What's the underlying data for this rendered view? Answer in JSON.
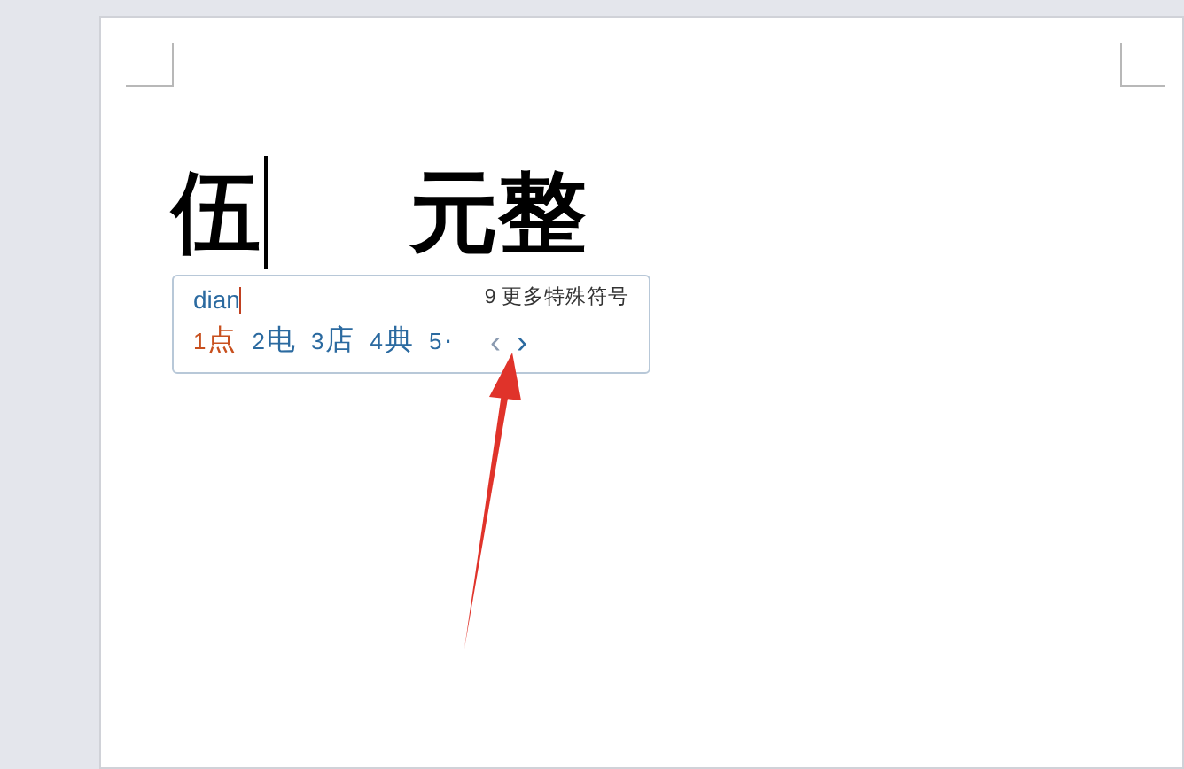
{
  "document": {
    "text_before_cursor": "伍",
    "text_after_cursor": "元整"
  },
  "ime": {
    "input": "dian",
    "more_symbols": "9 更多特殊符号",
    "candidates": [
      {
        "index": "1",
        "text": "点",
        "selected": true
      },
      {
        "index": "2",
        "text": "电",
        "selected": false
      },
      {
        "index": "3",
        "text": "店",
        "selected": false
      },
      {
        "index": "4",
        "text": "典",
        "selected": false
      },
      {
        "index": "5",
        "text": "·",
        "selected": false
      }
    ],
    "prev_page": {
      "label": "‹",
      "disabled": true
    },
    "next_page": {
      "label": "›",
      "disabled": false
    }
  }
}
